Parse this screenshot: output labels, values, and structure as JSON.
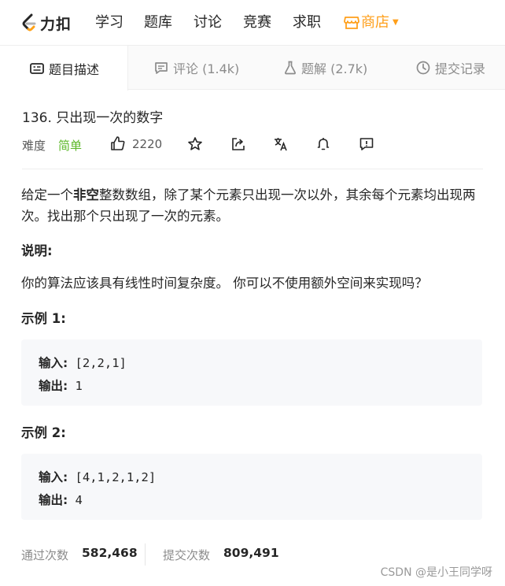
{
  "nav": {
    "logo_text": "力扣",
    "items": [
      "学习",
      "题库",
      "讨论",
      "竞赛",
      "求职"
    ],
    "store_label": "商店",
    "accent_color": "#ff9f1a"
  },
  "tabs": [
    {
      "label": "题目描述",
      "icon": "description-icon",
      "active": true
    },
    {
      "label": "评论 (1.4k)",
      "icon": "comment-icon",
      "active": false
    },
    {
      "label": "题解 (2.7k)",
      "icon": "flask-icon",
      "active": false
    },
    {
      "label": "提交记录",
      "icon": "clock-icon",
      "active": false
    }
  ],
  "problem": {
    "title": "136. 只出现一次的数字",
    "difficulty_label": "难度",
    "difficulty": "简单",
    "difficulty_color": "#5ab726",
    "likes": "2220",
    "action_icons": [
      "star-icon",
      "share-icon",
      "translate-icon",
      "bell-icon",
      "feedback-icon"
    ]
  },
  "description": {
    "intro_before": "给定一个",
    "intro_bold": "非空",
    "intro_after": "整数数组，除了某个元素只出现一次以外，其余每个元素均出现两次。找出那个只出现了一次的元素。",
    "note_heading": "说明:",
    "note_text": "你的算法应该具有线性时间复杂度。 你可以不使用额外空间来实现吗？"
  },
  "examples": [
    {
      "heading": "示例 1:",
      "input_label": "输入:",
      "input": "[2,2,1]",
      "output_label": "输出:",
      "output": "1"
    },
    {
      "heading": "示例 2:",
      "input_label": "输入:",
      "input": "[4,1,2,1,2]",
      "output_label": "输出:",
      "output": "4"
    }
  ],
  "stats": {
    "accepted_label": "通过次数",
    "accepted_value": "582,468",
    "submitted_label": "提交次数",
    "submitted_value": "809,491"
  },
  "watermark": "CSDN @是小王同学呀"
}
